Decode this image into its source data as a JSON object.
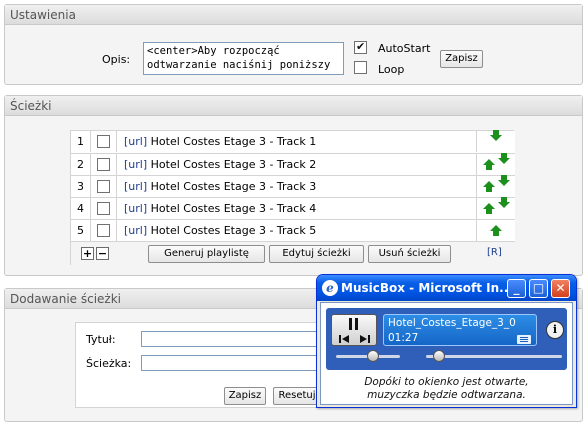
{
  "settings": {
    "header": "Ustawienia",
    "opis_label": "Opis:",
    "opis_value": "<center>Aby rozpocząć odtwarzanie naciśnij poniższy",
    "autostart_label": "AutoStart",
    "autostart_checked": true,
    "loop_label": "Loop",
    "loop_checked": false,
    "save_label": "Zapisz"
  },
  "tracks": {
    "header": "Ścieżki",
    "url_tag": "[url]",
    "rows": [
      {
        "num": "1",
        "title": "Hotel Costes Etage 3 - Track 1",
        "arrows": [
          "down"
        ]
      },
      {
        "num": "2",
        "title": "Hotel Costes Etage 3 - Track 2",
        "arrows": [
          "up",
          "down"
        ]
      },
      {
        "num": "3",
        "title": "Hotel Costes Etage 3 - Track 3",
        "arrows": [
          "up",
          "down"
        ]
      },
      {
        "num": "4",
        "title": "Hotel Costes Etage 3 - Track 4",
        "arrows": [
          "up",
          "down"
        ]
      },
      {
        "num": "5",
        "title": "Hotel Costes Etage 3 - Track 5",
        "arrows": [
          "up"
        ]
      }
    ],
    "add_label": "+",
    "remove_label": "−",
    "generate_label": "Generuj playlistę",
    "edit_label": "Edytuj ścieżki",
    "delete_label": "Usuń ścieżki",
    "r_link": "[R]"
  },
  "add_track": {
    "header": "Dodawanie ścieżki",
    "title_label": "Tytuł:",
    "path_label": "Ścieżka:",
    "save_label": "Zapisz",
    "reset_label": "Resetuj"
  },
  "musicbox": {
    "window_title": "MusicBox - Microsoft In...",
    "ie_icon": "e",
    "minimize": "_",
    "maximize": "□",
    "close": "✕",
    "track_name": "Hotel_Costes_Etage_3_0",
    "time": "01:27",
    "info_icon": "i",
    "note_line1": "Dopóki to okienko jest otwarte,",
    "note_line2": "muzyczka będzie odtwarzana.",
    "progress_fraction": 0.16,
    "volume_fraction": 0.55
  }
}
